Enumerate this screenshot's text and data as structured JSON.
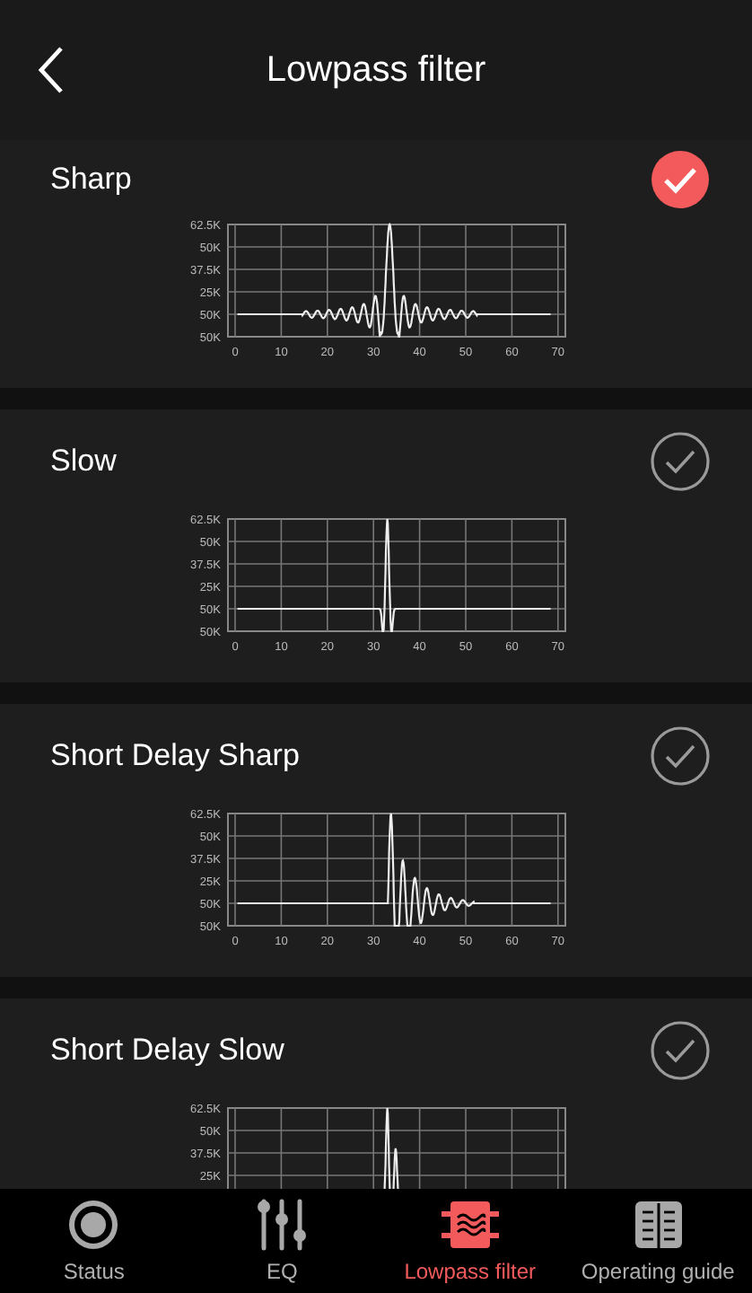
{
  "header": {
    "title": "Lowpass filter"
  },
  "filters": [
    {
      "name": "Sharp",
      "selected": true,
      "kind": "sharp",
      "y_labels": [
        "62.5K",
        "50K",
        "37.5K",
        "25K",
        "50K",
        "50K"
      ],
      "x_labels": [
        "0",
        "10",
        "20",
        "30",
        "40",
        "50",
        "60",
        "70"
      ]
    },
    {
      "name": "Slow",
      "selected": false,
      "kind": "slow",
      "y_labels": [
        "62.5K",
        "50K",
        "37.5K",
        "25K",
        "50K",
        "50K"
      ],
      "x_labels": [
        "0",
        "10",
        "20",
        "30",
        "40",
        "50",
        "60",
        "70"
      ]
    },
    {
      "name": "Short Delay Sharp",
      "selected": false,
      "kind": "short_sharp",
      "y_labels": [
        "62.5K",
        "50K",
        "37.5K",
        "25K",
        "50K",
        "50K"
      ],
      "x_labels": [
        "0",
        "10",
        "20",
        "30",
        "40",
        "50",
        "60",
        "70"
      ]
    },
    {
      "name": "Short Delay Slow",
      "selected": false,
      "kind": "short_slow",
      "y_labels": [
        "62.5K",
        "50K",
        "37.5K",
        "25K"
      ]
    }
  ],
  "nav": [
    {
      "label": "Status",
      "kind": "status",
      "selected": false
    },
    {
      "label": "EQ",
      "kind": "eq",
      "selected": false
    },
    {
      "label": "Lowpass filter",
      "kind": "filter",
      "selected": true
    },
    {
      "label": "Operating guide",
      "kind": "guide",
      "selected": false
    }
  ]
}
